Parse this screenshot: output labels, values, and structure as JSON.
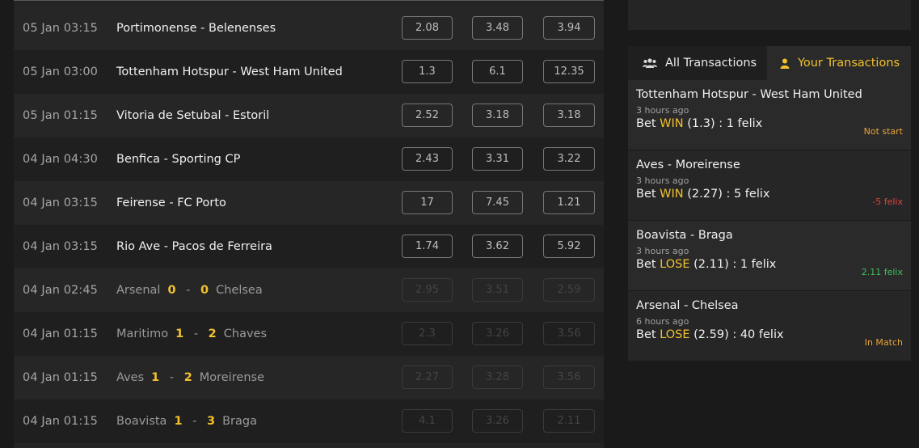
{
  "matches": [
    {
      "time": "05 Jan 03:15",
      "home": "Portimonense",
      "away": "Belenenses",
      "odds": [
        "2.08",
        "3.48",
        "3.94"
      ],
      "finished": false
    },
    {
      "time": "05 Jan 03:00",
      "home": "Tottenham Hotspur",
      "away": "West Ham United",
      "odds": [
        "1.3",
        "6.1",
        "12.35"
      ],
      "finished": false
    },
    {
      "time": "05 Jan 01:15",
      "home": "Vitoria de Setubal",
      "away": "Estoril",
      "odds": [
        "2.52",
        "3.18",
        "3.18"
      ],
      "finished": false
    },
    {
      "time": "04 Jan 04:30",
      "home": "Benfica",
      "away": "Sporting CP",
      "odds": [
        "2.43",
        "3.31",
        "3.22"
      ],
      "finished": false
    },
    {
      "time": "04 Jan 03:15",
      "home": "Feirense",
      "away": "FC Porto",
      "odds": [
        "17",
        "7.45",
        "1.21"
      ],
      "finished": false
    },
    {
      "time": "04 Jan 03:15",
      "home": "Rio Ave",
      "away": "Pacos de Ferreira",
      "odds": [
        "1.74",
        "3.62",
        "5.92"
      ],
      "finished": false
    },
    {
      "time": "04 Jan 02:45",
      "home": "Arsenal",
      "away": "Chelsea",
      "home_score": "0",
      "away_score": "0",
      "odds": [
        "2.95",
        "3.51",
        "2.59"
      ],
      "finished": true
    },
    {
      "time": "04 Jan 01:15",
      "home": "Maritimo",
      "away": "Chaves",
      "home_score": "1",
      "away_score": "2",
      "odds": [
        "2.3",
        "3.26",
        "3.56"
      ],
      "finished": true
    },
    {
      "time": "04 Jan 01:15",
      "home": "Aves",
      "away": "Moreirense",
      "home_score": "1",
      "away_score": "2",
      "odds": [
        "2.27",
        "3.28",
        "3.56"
      ],
      "finished": true
    },
    {
      "time": "04 Jan 01:15",
      "home": "Boavista",
      "away": "Braga",
      "home_score": "1",
      "away_score": "3",
      "odds": [
        "4.1",
        "3.26",
        "2.11"
      ],
      "finished": true
    }
  ],
  "tabs": {
    "all": "All Transactions",
    "yours": "Your Transactions"
  },
  "transactions": [
    {
      "match": "Tottenham Hotspur - West Ham United",
      "ago": "3 hours ago",
      "bet_prefix": "Bet",
      "pick": "WIN",
      "rest": "(1.3) : 1 felix",
      "status": "Not start",
      "status_color": "#e8a33a"
    },
    {
      "match": "Aves - Moreirense",
      "ago": "3 hours ago",
      "bet_prefix": "Bet",
      "pick": "WIN",
      "rest": "(2.27) : 5 felix",
      "status": "-5 felix",
      "status_color": "#e0413a"
    },
    {
      "match": "Boavista - Braga",
      "ago": "3 hours ago",
      "bet_prefix": "Bet",
      "pick": "LOSE",
      "rest": "(2.11) : 1 felix",
      "status": "2.11 felix",
      "status_color": "#3fbf5a"
    },
    {
      "match": "Arsenal - Chelsea",
      "ago": "6 hours ago",
      "bet_prefix": "Bet",
      "pick": "LOSE",
      "rest": "(2.59) : 40 felix",
      "status": "In Match",
      "status_color": "#e8a33a"
    }
  ],
  "colors": {
    "accent": "#f2c12e",
    "background": "#1a1a1a"
  },
  "icons": {
    "all_tab": "users-icon",
    "your_tab": "user-icon"
  }
}
